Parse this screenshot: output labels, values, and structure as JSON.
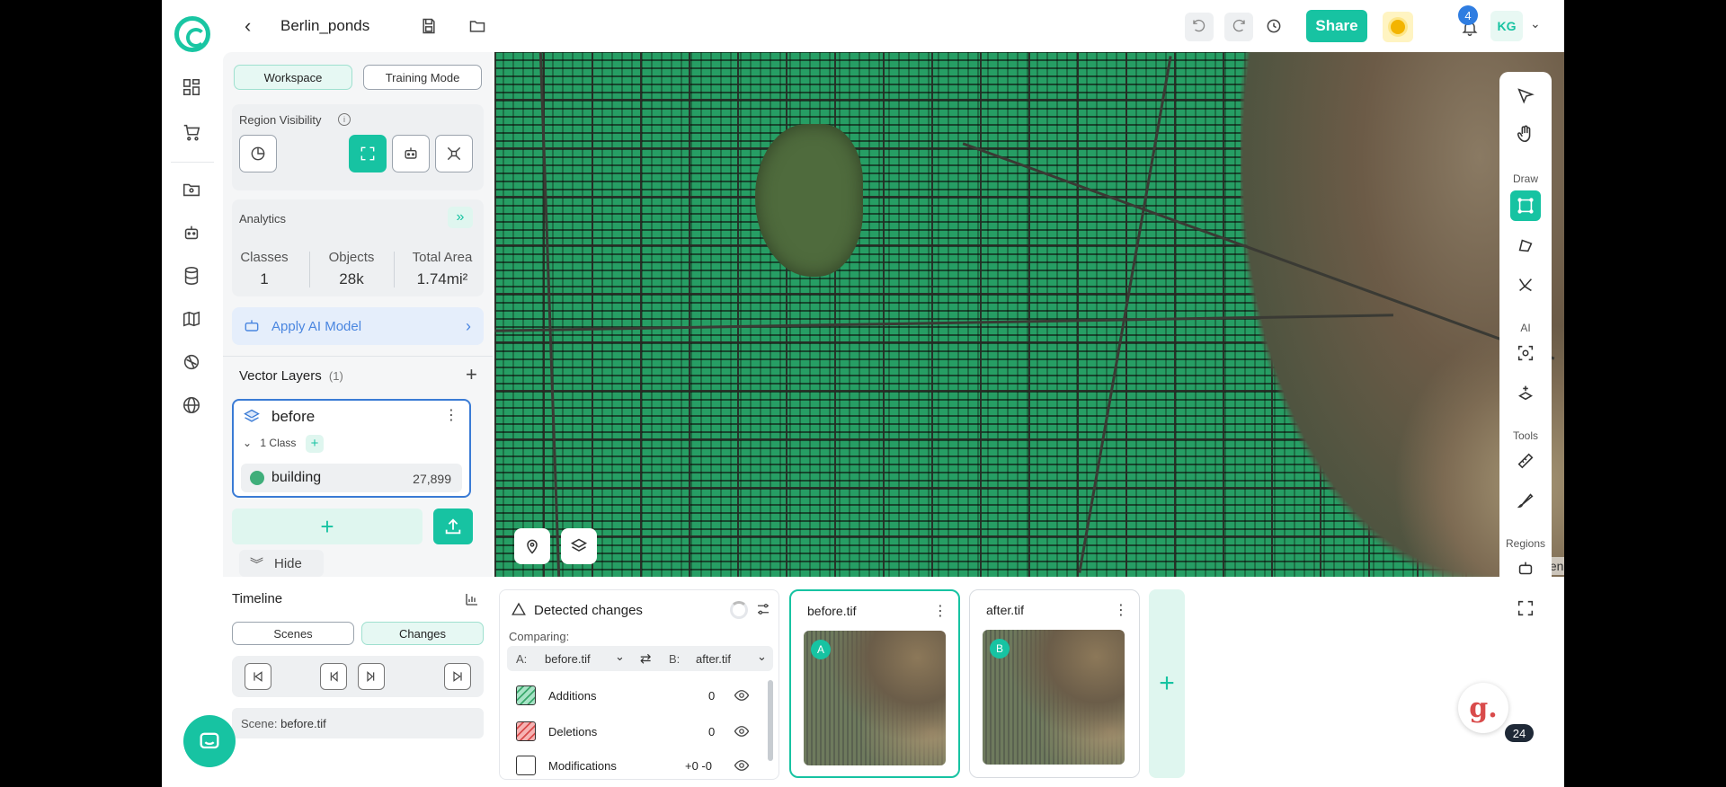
{
  "header": {
    "project_title": "Berlin_ponds",
    "share_label": "Share",
    "notification_count": "4",
    "user_initials": "KG"
  },
  "panel": {
    "mode_tabs": [
      {
        "label": "Workspace",
        "active": true
      },
      {
        "label": "Training Mode",
        "active": false
      }
    ],
    "region_visibility_label": "Region Visibility",
    "analytics": {
      "label": "Analytics",
      "stats": [
        {
          "key": "Classes",
          "value": "1"
        },
        {
          "key": "Objects",
          "value": "28k"
        },
        {
          "key": "Total Area",
          "value": "1.74mi²"
        }
      ]
    },
    "apply_ai_label": "Apply AI Model",
    "vector_layers_label": "Vector Layers",
    "vector_layers_count": "(1)",
    "layer": {
      "name": "before",
      "class_count_label": "1 Class",
      "class_name": "building",
      "class_count": "27,899",
      "class_color": "#3fae7a"
    },
    "hide_label": "Hide"
  },
  "map": {
    "attribution": "© OpenStreetMap con"
  },
  "right_toolbar": {
    "sections": [
      "Draw",
      "AI",
      "Tools",
      "Regions"
    ]
  },
  "timeline": {
    "title": "Timeline",
    "tabs": [
      {
        "label": "Scenes",
        "active": false
      },
      {
        "label": "Changes",
        "active": true
      }
    ],
    "scene_label": "Scene:",
    "scene_value": "before.tif"
  },
  "detected_changes": {
    "title": "Detected changes",
    "comparing_label": "Comparing:",
    "a_label": "A:",
    "a_value": "before.tif",
    "b_label": "B:",
    "b_value": "after.tif",
    "rows": [
      {
        "label": "Additions",
        "value": "0"
      },
      {
        "label": "Deletions",
        "value": "0"
      },
      {
        "label": "Modifications",
        "value": "+0 -0"
      }
    ]
  },
  "images": [
    {
      "name": "before.tif",
      "tag": "A"
    },
    {
      "name": "after.tif",
      "tag": "B"
    }
  ],
  "chat_badge_count": "24",
  "accent_color": "#17c3a2"
}
